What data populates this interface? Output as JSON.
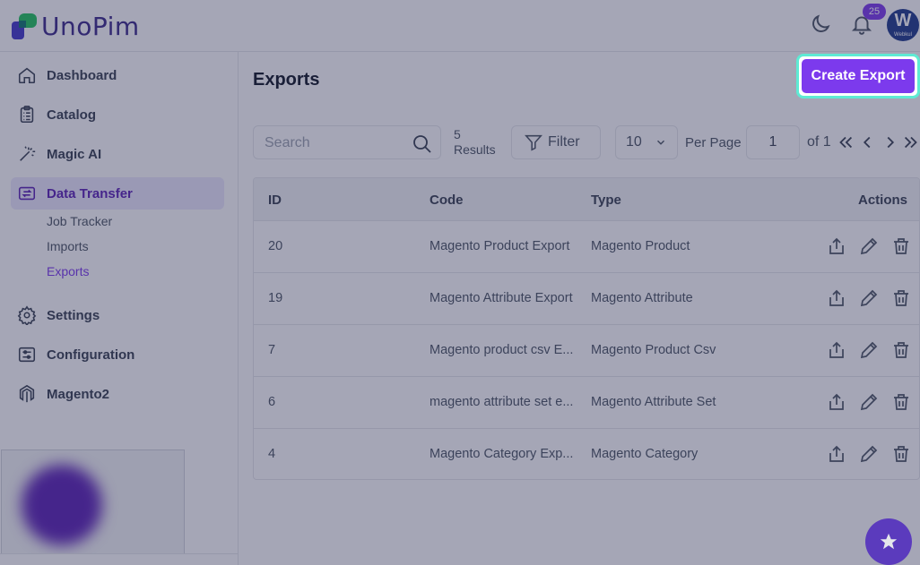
{
  "header": {
    "app_name": "UnoPim",
    "notification_count": "25",
    "avatar_letter": "W",
    "avatar_brand": "Webkul"
  },
  "sidebar": {
    "items": [
      {
        "label": "Dashboard",
        "icon": "home-icon"
      },
      {
        "label": "Catalog",
        "icon": "clipboard-list-icon"
      },
      {
        "label": "Magic AI",
        "icon": "magic-wand-icon"
      },
      {
        "label": "Data Transfer",
        "icon": "data-transfer-icon",
        "active": true
      },
      {
        "label": "Settings",
        "icon": "gear-icon"
      },
      {
        "label": "Configuration",
        "icon": "sliders-icon"
      },
      {
        "label": "Magento2",
        "icon": "magento-icon"
      }
    ],
    "sub_items": [
      {
        "label": "Job Tracker"
      },
      {
        "label": "Imports"
      },
      {
        "label": "Exports",
        "active": true
      }
    ]
  },
  "main": {
    "title": "Exports",
    "create_button": "Create Export",
    "search_placeholder": "Search",
    "results_count": "5",
    "results_label": "Results",
    "filter_label": "Filter",
    "per_page_value": "10",
    "per_page_label": "Per Page",
    "current_page": "1",
    "of_label": "of 1",
    "table": {
      "headers": {
        "id": "ID",
        "code": "Code",
        "type": "Type",
        "actions": "Actions"
      },
      "rows": [
        {
          "id": "20",
          "code": "Magento Product Export",
          "type": "Magento Product"
        },
        {
          "id": "19",
          "code": "Magento Attribute Export",
          "type": "Magento Attribute"
        },
        {
          "id": "7",
          "code": "Magento product csv E...",
          "type": "Magento Product Csv"
        },
        {
          "id": "6",
          "code": "magento attribute set e...",
          "type": "Magento Attribute Set"
        },
        {
          "id": "4",
          "code": "Magento Category Exp...",
          "type": "Magento Category"
        }
      ]
    }
  },
  "colors": {
    "primary": "#7c3aed",
    "focus_ring": "#5eead4",
    "overlay": "#282c50"
  }
}
